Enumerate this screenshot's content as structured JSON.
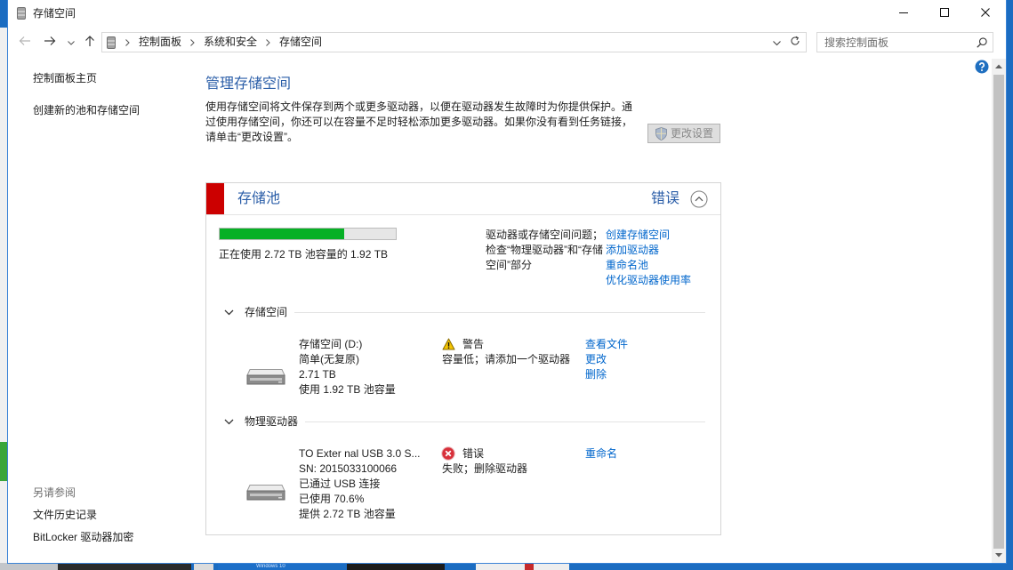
{
  "window": {
    "title": "存储空间",
    "title_icon": "storage-spaces-icon"
  },
  "icons": {
    "minimize": "minimize-icon",
    "maximize": "maximize-icon",
    "close": "close-icon",
    "back": "back-arrow-icon",
    "forward": "forward-arrow-icon",
    "recent": "chevron-down-icon",
    "up": "up-arrow-icon",
    "refresh": "refresh-icon",
    "search": "search-icon",
    "help": "help-icon",
    "shield": "uac-shield-icon",
    "collapse": "collapse-up-icon",
    "drive": "drive-icon"
  },
  "toolbar": {
    "breadcrumb": [
      "控制面板",
      "系统和安全",
      "存储空间"
    ],
    "search_placeholder": "搜索控制面板"
  },
  "sidebar": {
    "links": [
      "控制面板主页",
      "创建新的池和存储空间"
    ],
    "see_also_title": "另请参阅",
    "see_also_links": [
      "文件历史记录",
      "BitLocker 驱动器加密"
    ]
  },
  "main": {
    "heading": "管理存储空间",
    "description_lines": [
      "使用存储空间将文件保存到两个或更多驱动器，以便在驱动器发生故障时为你提供保护。通",
      "过使用存储空间，你还可以在容量不足时轻松添加更多驱动器。如果你没有看到任务链接，",
      "请单击“更改设置”。"
    ],
    "change_settings_label": "更改设置"
  },
  "pool": {
    "title": "存储池",
    "status": "错误",
    "usage_fraction": 0.706,
    "usage_text": "正在使用 2.72 TB 池容量的 1.92 TB",
    "message_lines": [
      "驱动器或存储空间问题；",
      "检查“物理驱动器”和“存储",
      "空间”部分"
    ],
    "tasks": [
      "创建存储空间",
      "添加驱动器",
      "重命名池",
      "优化驱动器使用率"
    ],
    "spaces_section": {
      "label": "存储空间",
      "items": [
        {
          "details": [
            "存储空间 (D:)",
            "简单(无复原)",
            "2.71 TB",
            "使用 1.92 TB 池容量"
          ],
          "status_icon": "warning-icon",
          "status": "警告",
          "status_detail": "容量低；请添加一个驱动器",
          "actions": [
            "查看文件",
            "更改",
            "删除"
          ]
        }
      ]
    },
    "drives_section": {
      "label": "物理驱动器",
      "items": [
        {
          "details": [
            "TO Exter nal USB 3.0 S...",
            "SN: 2015033100066",
            "已通过 USB 连接",
            "已使用 70.6%",
            "提供 2.72 TB 池容量"
          ],
          "status_icon": "error-icon",
          "status": "错误",
          "status_detail": "失败；删除驱动器",
          "actions": [
            "重命名"
          ]
        }
      ]
    }
  },
  "desktop": {
    "thumbnail_label": "Windows 10"
  },
  "colors": {
    "link": "#0066cc",
    "heading": "#2b5ea8",
    "pool_error": "#cc0000",
    "progress_fill": "#06b025"
  }
}
